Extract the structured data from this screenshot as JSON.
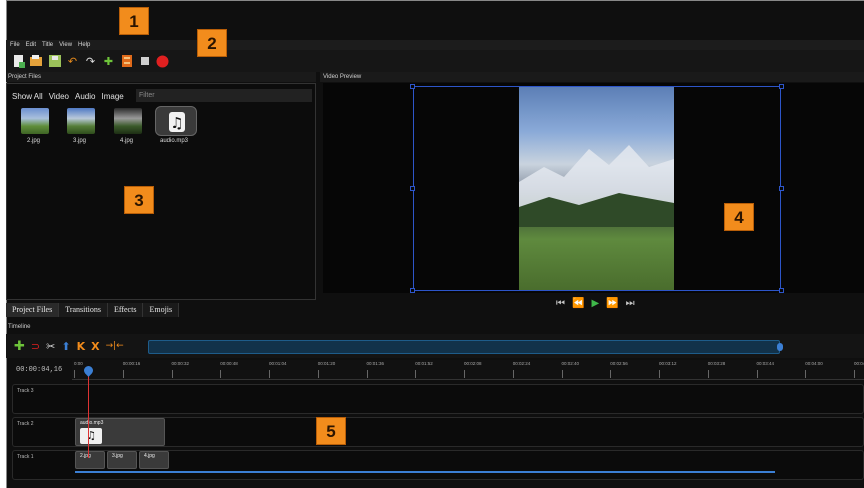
{
  "colors": {
    "accent_orange": "#f28c1c",
    "playhead": "#d33333",
    "selection_blue": "#3b7fd4",
    "guide": "#2d55c9"
  },
  "menu": [
    "File",
    "Edit",
    "Title",
    "View",
    "Help"
  ],
  "toolbar_icons": [
    "new-project-icon",
    "open-project-icon",
    "save-project-icon",
    "undo-icon",
    "redo-icon",
    "import-files-icon",
    "choose-profile-icon",
    "fullscreen-icon",
    "export-video-icon"
  ],
  "project_files": {
    "header": "Project Files",
    "filters": [
      "Show All",
      "Video",
      "Audio",
      "Image"
    ],
    "filter_placeholder": "Filter",
    "files": [
      {
        "name": "2.jpg",
        "icon": "image-thumbnail"
      },
      {
        "name": "3.jpg",
        "icon": "image-thumbnail"
      },
      {
        "name": "4.jpg",
        "icon": "image-thumbnail"
      },
      {
        "name": "audio.mp3",
        "icon": "music-note-icon"
      }
    ]
  },
  "video_preview": {
    "header": "Video Preview",
    "controls": [
      "jump-start-icon",
      "rewind-icon",
      "play-icon",
      "fast-forward-icon",
      "jump-end-icon"
    ]
  },
  "tabs": [
    "Project Files",
    "Transitions",
    "Effects",
    "Emojis"
  ],
  "timeline": {
    "label": "Timeline",
    "timecode": "00:00:04,16",
    "ticks": [
      "0:00",
      "00:00:16",
      "00:00:32",
      "00:00:48",
      "00:01:04",
      "00:01:20",
      "00:01:36",
      "00:01:52",
      "00:02:08",
      "00:02:24",
      "00:02:40",
      "00:02:56",
      "00:03:12",
      "00:03:28",
      "00:03:44",
      "00:04:00",
      "00:04:16"
    ],
    "tracks": [
      {
        "name": "Track 3",
        "clips": []
      },
      {
        "name": "Track 2",
        "clips": [
          "audio.mp3"
        ]
      },
      {
        "name": "Track 1",
        "clips": [
          "2.jpg",
          "3.jpg",
          "4.jpg"
        ]
      }
    ]
  },
  "callouts": [
    "1",
    "2",
    "3",
    "4",
    "5"
  ]
}
